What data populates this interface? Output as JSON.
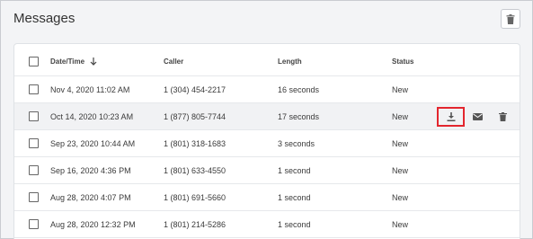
{
  "page": {
    "title": "Messages"
  },
  "toolbar": {
    "delete_icon": "trash-icon"
  },
  "table": {
    "columns": {
      "date": "Date/Time",
      "caller": "Caller",
      "length": "Length",
      "status": "Status"
    },
    "sort_icon": "arrow-down-icon",
    "rows": [
      {
        "date": "Nov 4, 2020 11:02 AM",
        "caller": "1 (304) 454-2217",
        "length": "16 seconds",
        "status": "New"
      },
      {
        "date": "Oct 14, 2020 10:23 AM",
        "caller": "1 (877) 805-7744",
        "length": "17 seconds",
        "status": "New",
        "highlighted": true,
        "actions": [
          "download-icon",
          "envelope-icon",
          "trash-icon"
        ]
      },
      {
        "date": "Sep 23, 2020 10:44 AM",
        "caller": "1 (801) 318-1683",
        "length": "3 seconds",
        "status": "New"
      },
      {
        "date": "Sep 16, 2020 4:36 PM",
        "caller": "1 (801) 633-4550",
        "length": "1 second",
        "status": "New"
      },
      {
        "date": "Aug 28, 2020 4:07 PM",
        "caller": "1 (801) 691-5660",
        "length": "1 second",
        "status": "New"
      },
      {
        "date": "Aug 28, 2020 12:32 PM",
        "caller": "1 (801) 214-5286",
        "length": "1 second",
        "status": "New"
      }
    ]
  },
  "colors": {
    "highlight_border": "#e3262e",
    "row_hover": "#f1f2f4",
    "icon": "#555555"
  }
}
